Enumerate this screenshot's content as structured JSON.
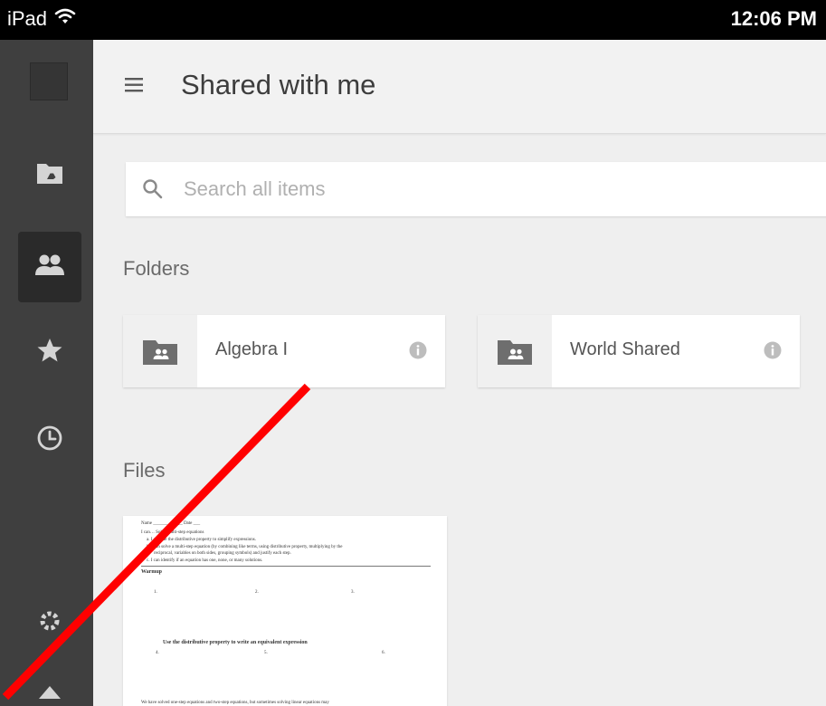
{
  "status_bar": {
    "device": "iPad",
    "time": "12:06 PM"
  },
  "sidebar": {
    "items": [
      {
        "name": "my-drive",
        "icon": "drive-folder-icon"
      },
      {
        "name": "shared-with-me",
        "icon": "people-icon",
        "active": true
      },
      {
        "name": "starred",
        "icon": "star-icon"
      },
      {
        "name": "recent",
        "icon": "clock-icon"
      }
    ]
  },
  "header": {
    "title": "Shared with me",
    "menu_icon": "hamburger-icon"
  },
  "search": {
    "placeholder": "Search all items",
    "value": ""
  },
  "folders": {
    "label": "Folders",
    "items": [
      {
        "name": "Algebra I"
      },
      {
        "name": "World Shared"
      }
    ]
  },
  "files": {
    "label": "Files",
    "preview": {
      "line1": "Name _____________ Date ___",
      "line2": "I can… Solve multi-step equations",
      "line3": "a.   I can use the distributive property to simplify expressions.",
      "line4": "b.   I can solve a multi-step equation (by combining like terms, using distributive property, multiplying by the",
      "line5": "reciprocal, variables on both sides, grouping symbols) and justify each step.",
      "line6": "c.   I can identify if an equation has one, none, or many solutions.",
      "warmup": "Warmup",
      "n1": "1.",
      "n2": "2.",
      "n3": "3.",
      "instruction": "Use the distributive property to write an equivalent expression",
      "n4": "4.",
      "n5": "5.",
      "n6": "6.",
      "bottom_line": "We have solved one-step equations and two-step equations, but sometimes solving linear equations may"
    }
  },
  "colors": {
    "status_bar": "#000000",
    "sidebar": "#3f3f3f",
    "sidebar_active": "#2a2a2a",
    "background": "#efefef",
    "annotation_line": "#ff0000"
  }
}
